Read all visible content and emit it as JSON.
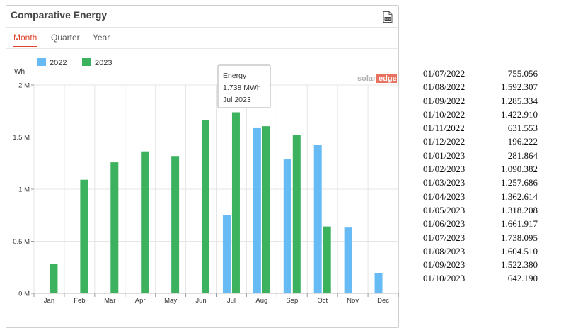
{
  "widget": {
    "title": "Comparative Energy",
    "export_icon": "csv-export-icon",
    "tabs": [
      {
        "label": "Month",
        "active": true
      },
      {
        "label": "Quarter",
        "active": false
      },
      {
        "label": "Year",
        "active": false
      }
    ],
    "brand_text_a": "solar",
    "brand_text_b": "edge"
  },
  "tooltip": {
    "line1": "Energy",
    "line2": "1.738 MWh",
    "line3": "Jul 2023"
  },
  "colors": {
    "series_2022": "#66bbf5",
    "series_2023": "#3cb25e",
    "accent": "#e0412b",
    "grid": "#e6e6e6"
  },
  "chart_data": {
    "type": "bar",
    "ylabel": "Wh",
    "ylim": [
      0,
      2000000
    ],
    "yticks": [
      {
        "value": 0,
        "label": "0 M"
      },
      {
        "value": 500000,
        "label": "0.5 M"
      },
      {
        "value": 1000000,
        "label": "1 M"
      },
      {
        "value": 1500000,
        "label": "1.5 M"
      },
      {
        "value": 2000000,
        "label": "2 M"
      }
    ],
    "categories": [
      "Jan",
      "Feb",
      "Mar",
      "Apr",
      "May",
      "Jun",
      "Jul",
      "Aug",
      "Sep",
      "Oct",
      "Nov",
      "Dec"
    ],
    "legend_position": "top-left",
    "series": [
      {
        "name": "2022",
        "color": "#66bbf5",
        "values": [
          null,
          null,
          null,
          null,
          null,
          null,
          755056,
          1592307,
          1285334,
          1422910,
          631553,
          196222
        ]
      },
      {
        "name": "2023",
        "color": "#3cb25e",
        "values": [
          281864,
          1090382,
          1257686,
          1362614,
          1318208,
          1661917,
          1738095,
          1604510,
          1522380,
          642190,
          null,
          null
        ]
      }
    ]
  },
  "table": [
    {
      "date": "01/07/2022",
      "value": "755.056"
    },
    {
      "date": "01/08/2022",
      "value": "1.592.307"
    },
    {
      "date": "01/09/2022",
      "value": "1.285.334"
    },
    {
      "date": "01/10/2022",
      "value": "1.422.910"
    },
    {
      "date": "01/11/2022",
      "value": "631.553"
    },
    {
      "date": "01/12/2022",
      "value": "196.222"
    },
    {
      "date": "01/01/2023",
      "value": "281.864"
    },
    {
      "date": "01/02/2023",
      "value": "1.090.382"
    },
    {
      "date": "01/03/2023",
      "value": "1.257.686"
    },
    {
      "date": "01/04/2023",
      "value": "1.362.614"
    },
    {
      "date": "01/05/2023",
      "value": "1.318.208"
    },
    {
      "date": "01/06/2023",
      "value": "1.661.917"
    },
    {
      "date": "01/07/2023",
      "value": "1.738.095"
    },
    {
      "date": "01/08/2023",
      "value": "1.604.510"
    },
    {
      "date": "01/09/2023",
      "value": "1.522.380"
    },
    {
      "date": "01/10/2023",
      "value": "642.190"
    }
  ]
}
